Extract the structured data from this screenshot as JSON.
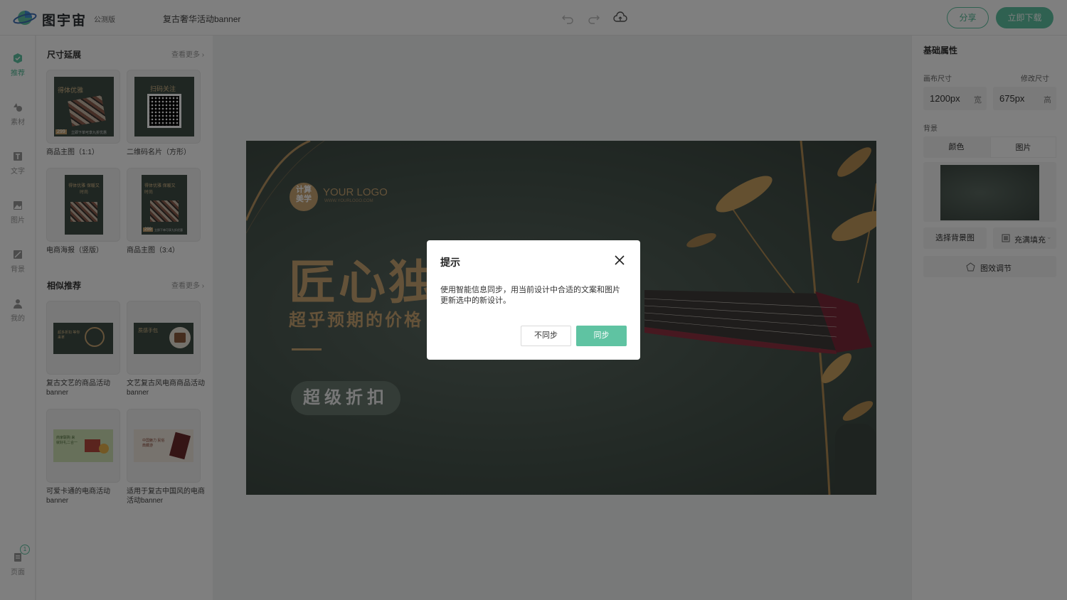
{
  "header": {
    "brand": "图宇宙",
    "beta_badge": "公测版",
    "doc_title": "复古奢华活动banner",
    "share_label": "分享",
    "download_label": "立即下载"
  },
  "leftnav": {
    "items": [
      {
        "label": "推荐",
        "icon": "recommend-icon"
      },
      {
        "label": "素材",
        "icon": "shapes-icon"
      },
      {
        "label": "文字",
        "icon": "text-icon"
      },
      {
        "label": "图片",
        "icon": "image-icon"
      },
      {
        "label": "背景",
        "icon": "background-icon"
      },
      {
        "label": "我的",
        "icon": "user-icon"
      }
    ],
    "pages_label": "页面",
    "pages_count": "1"
  },
  "panel": {
    "size_section": {
      "title": "尺寸延展",
      "more": "查看更多",
      "items": [
        {
          "caption": "商品主图（1:1）",
          "text1": "得体优雅",
          "price": "299",
          "strip": "立即下单可享九折优惠"
        },
        {
          "caption": "二维码名片（方形）",
          "text1": "扫码关注"
        },
        {
          "caption": "电商海报（竖版）",
          "text1": "得体优雅 保暖又时尚"
        },
        {
          "caption": "商品主图（3:4）",
          "text1": "得体优雅 保暖又时尚",
          "price": "299",
          "strip": "立即下单可享九折优惠"
        }
      ]
    },
    "similar_section": {
      "title": "相似推荐",
      "more": "查看更多",
      "items": [
        {
          "caption": "复古文艺的商品活动banner",
          "text1": "超多折扣 等你来拿"
        },
        {
          "caption": "文艺复古风电商商品活动banner",
          "text1": "质感手包"
        },
        {
          "caption": "可爱卡通的电商活动banner",
          "text1": "商家联购 来就好礼二合一"
        },
        {
          "caption": "适用于复古中国风的电商活动banner",
          "text1": "中国魅力 民俗典藏游"
        }
      ]
    }
  },
  "artboard": {
    "logo_seal": "计算美学",
    "logo_text": "YOUR LOGO",
    "logo_sub": "WWW.YOURLOGO.COM",
    "headline": "匠心独",
    "subline": "超乎预期的价格",
    "badge": "超级折扣"
  },
  "rightpanel": {
    "title": "基础属性",
    "canvas_size_label": "画布尺寸",
    "resize_label": "修改尺寸",
    "width_value": "1200px",
    "width_unit": "宽",
    "height_value": "675px",
    "height_unit": "高",
    "bg_label": "背景",
    "tab_color": "颜色",
    "tab_image": "图片",
    "choose_bg": "选择背景图",
    "fill_mode": "充满填充",
    "effects": "图效调节"
  },
  "dialog": {
    "title": "提示",
    "body": "使用智能信息同步，用当前设计中合适的文案和图片更新选中的新设计。",
    "cancel_label": "不同步",
    "confirm_label": "同步"
  },
  "colors": {
    "accent": "#5fc3a2",
    "art_bg": "#45534b",
    "gold": "#c9a472"
  }
}
